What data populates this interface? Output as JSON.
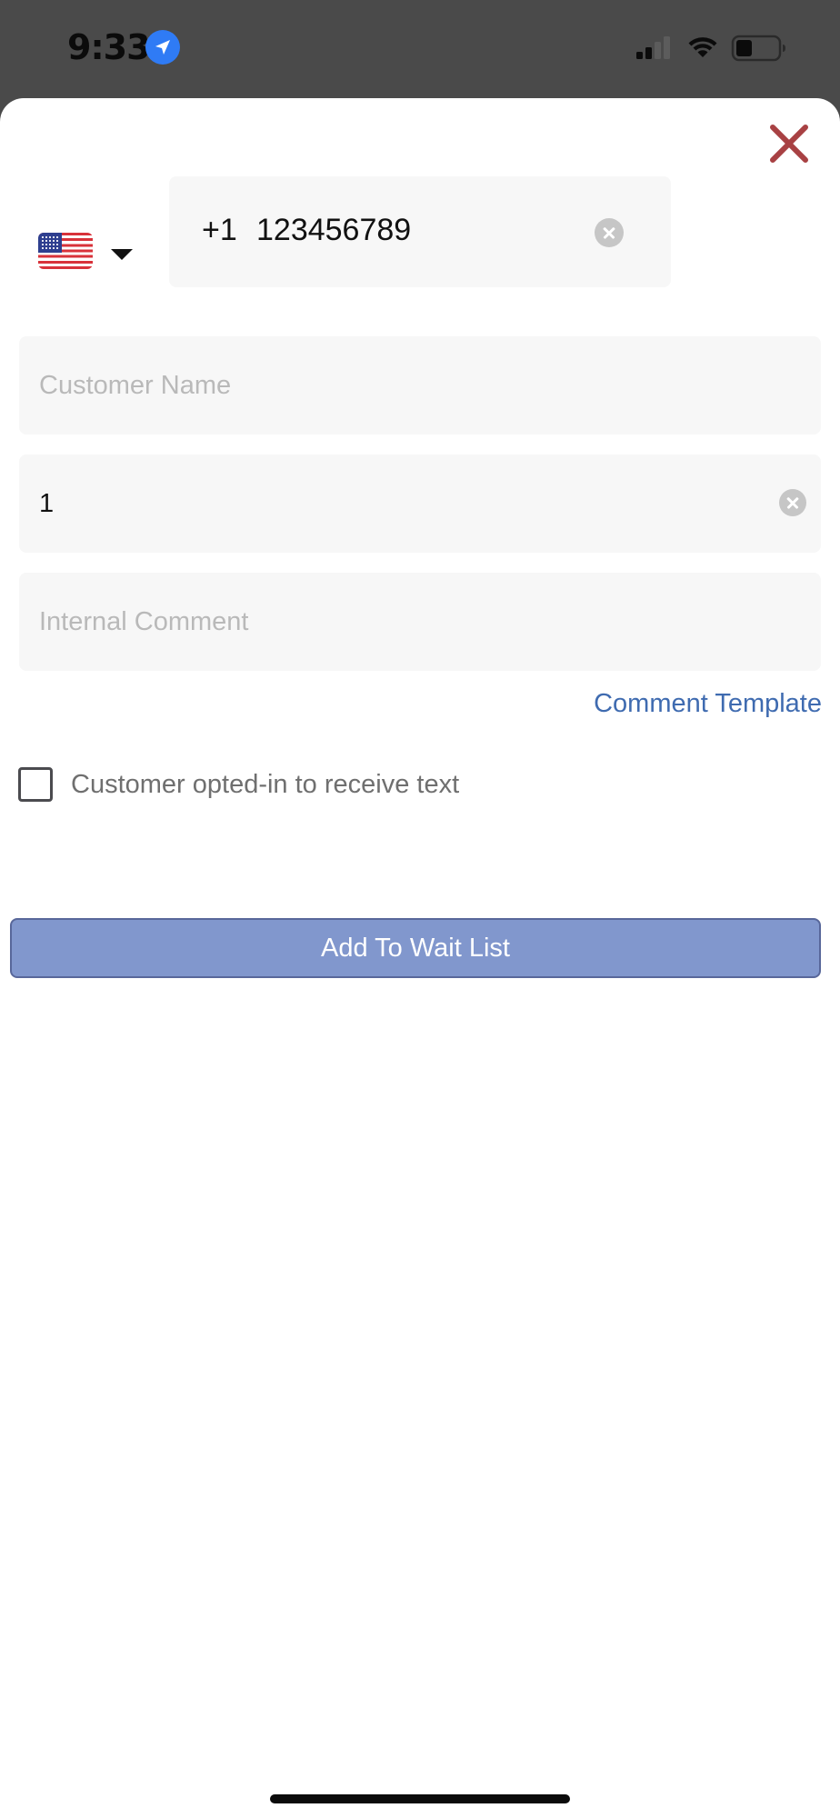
{
  "status_bar": {
    "time": "9:33",
    "location_icon": "location-arrow-icon",
    "signal_icon": "cellular-signal-icon",
    "wifi_icon": "wifi-icon",
    "battery_icon": "battery-icon"
  },
  "sheet": {
    "close_icon": "close-icon",
    "close_color": "#a84143",
    "country": {
      "flag_icon": "us-flag-icon",
      "dropdown_icon": "caret-down-icon"
    },
    "phone": {
      "country_code": "+1",
      "number": "123456789"
    },
    "customer_name": {
      "value": "",
      "placeholder": "Customer Name"
    },
    "party_size": {
      "value": "1"
    },
    "internal_comment": {
      "value": "",
      "placeholder": "Internal Comment"
    },
    "comment_template_label": "Comment Template",
    "opt_in": {
      "label": "Customer opted-in to receive text",
      "checked": false
    },
    "submit_label": "Add To Wait List"
  },
  "colors": {
    "link": "#3f6bb0",
    "button": "#8197cd",
    "field_background": "#f7f7f7"
  }
}
